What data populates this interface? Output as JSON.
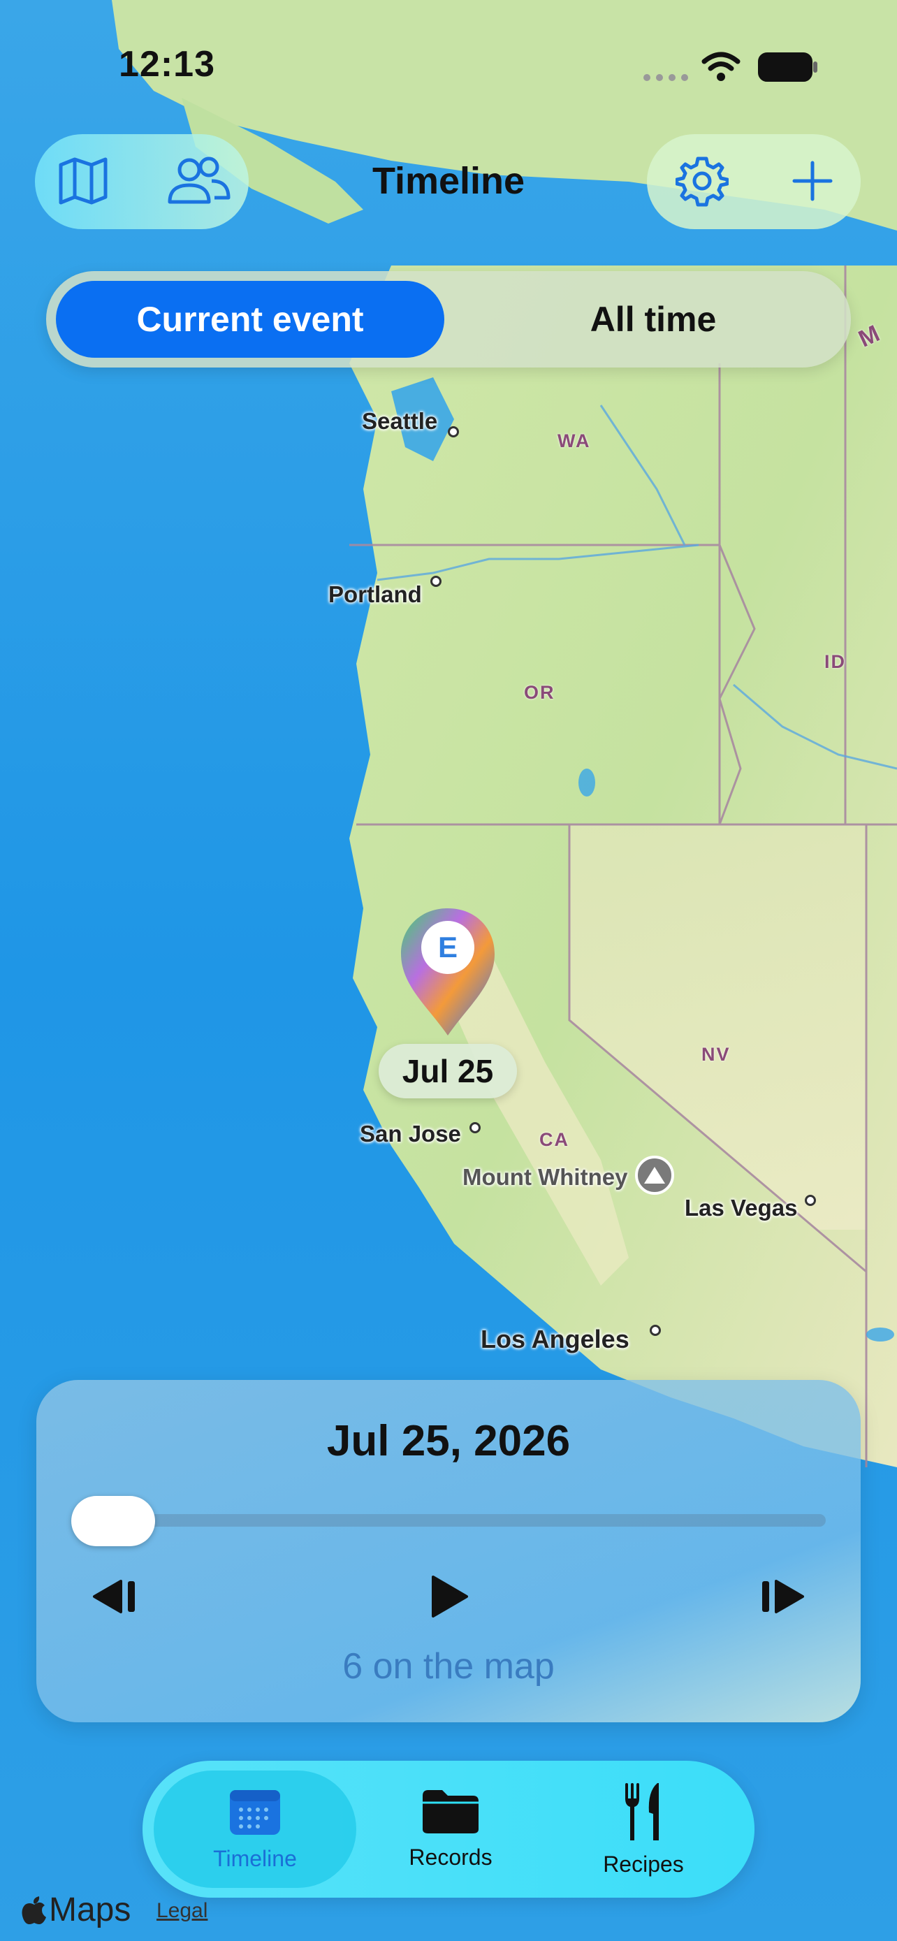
{
  "status_bar": {
    "time": "12:13"
  },
  "nav": {
    "title": "Timeline",
    "left_icons": [
      "map-icon",
      "people-icon"
    ],
    "right_icons": [
      "gear-icon",
      "plus-icon"
    ]
  },
  "segmented": {
    "options": [
      "Current event",
      "All time"
    ],
    "selected": "Current event"
  },
  "map": {
    "cities": [
      "Seattle",
      "Portland",
      "San Jose",
      "Las Vegas",
      "Los Angeles"
    ],
    "states": [
      "WA",
      "OR",
      "ID",
      "NV",
      "CA",
      "M"
    ],
    "landmark": "Mount Whitney",
    "pin": {
      "letter": "E",
      "date": "Jul 25"
    }
  },
  "timeline_panel": {
    "date": "Jul 25, 2026",
    "progress": 0,
    "count_text": "6 on the map"
  },
  "tabs": [
    {
      "label": "Timeline",
      "icon": "calendar-icon",
      "active": true
    },
    {
      "label": "Records",
      "icon": "folder-icon",
      "active": false
    },
    {
      "label": "Recipes",
      "icon": "fork-knife-icon",
      "active": false
    }
  ],
  "footer": {
    "maps_label": "Maps",
    "legal": "Legal"
  },
  "colors": {
    "accent": "#0a6ff2",
    "ocean": "#2a9be0",
    "land": "#c8e0a4"
  }
}
